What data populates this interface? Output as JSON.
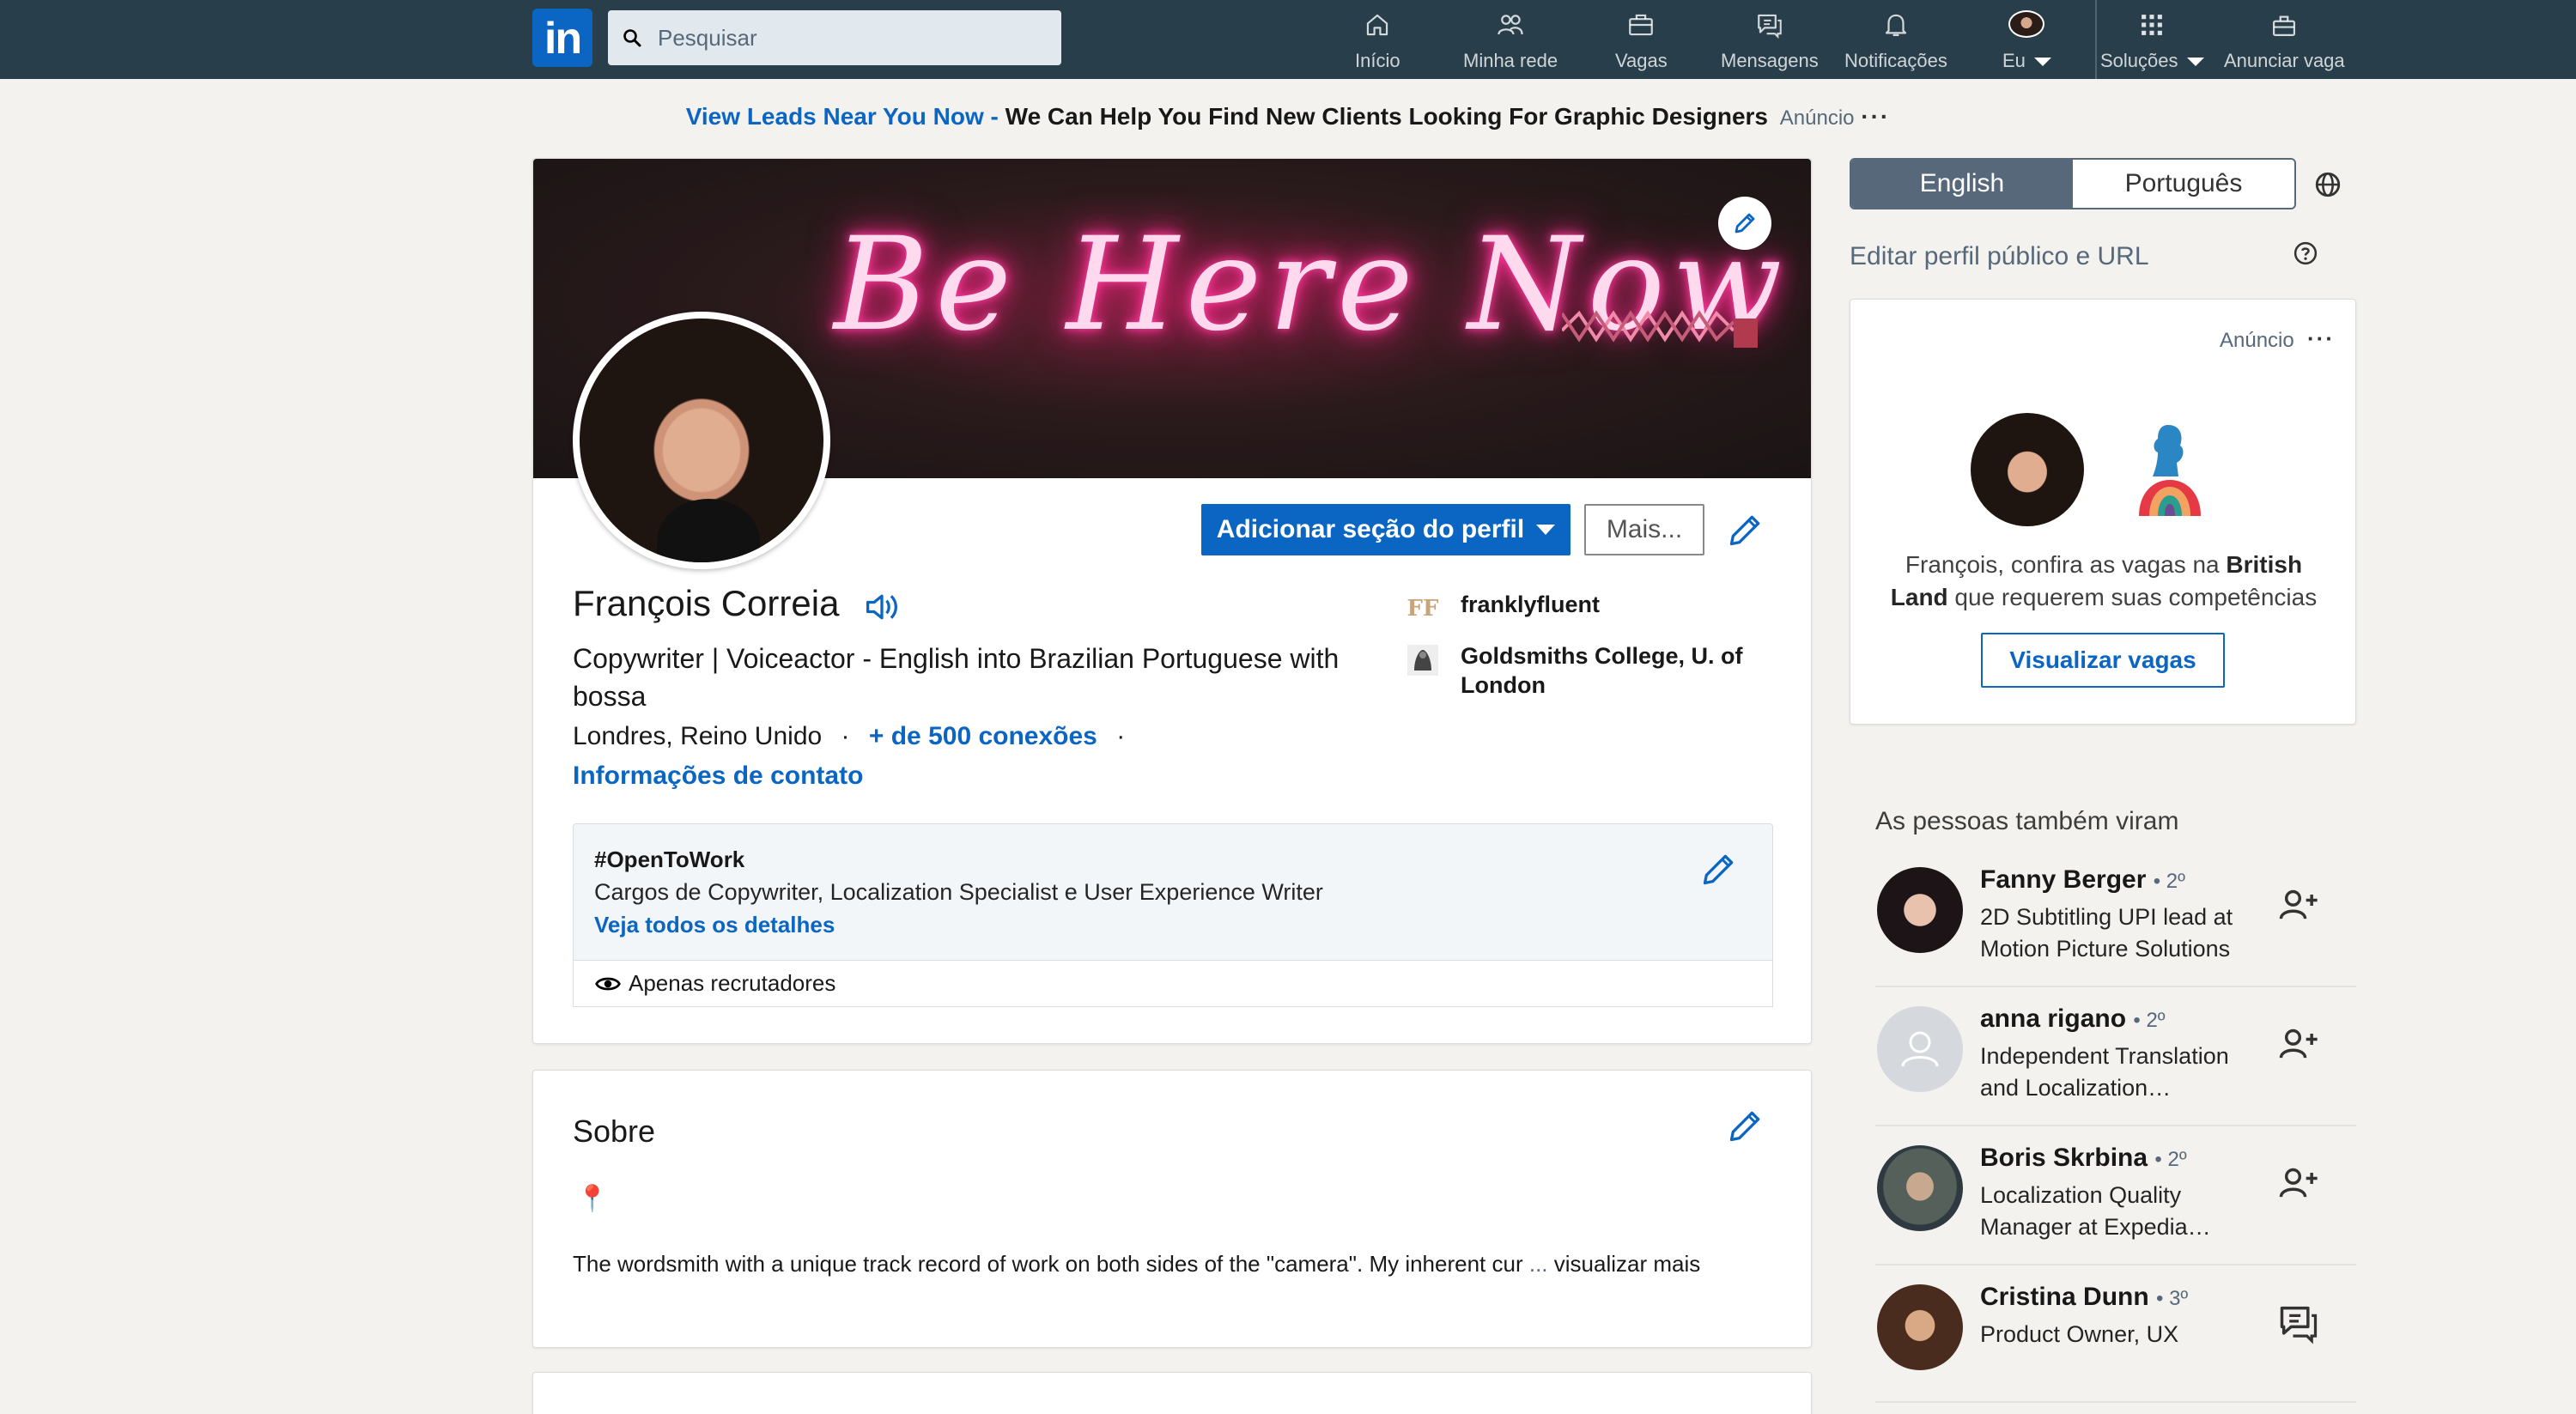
{
  "nav": {
    "logo": "in",
    "search_placeholder": "Pesquisar",
    "items": [
      {
        "label": "Início"
      },
      {
        "label": "Minha rede"
      },
      {
        "label": "Vagas"
      },
      {
        "label": "Mensagens"
      },
      {
        "label": "Notificações"
      },
      {
        "label": "Eu"
      },
      {
        "label": "Soluções"
      },
      {
        "label": "Anunciar vaga"
      }
    ]
  },
  "top_ad": {
    "link": "View Leads Near You Now",
    "separator": " - ",
    "text": "We Can Help You Find New Clients Looking For Graphic Designers",
    "label": "Anúncio",
    "dots": "···"
  },
  "profile": {
    "cover_text": "Be Here Now",
    "add_section_label": "Adicionar seção do perfil",
    "more_label": "Mais...",
    "name": "François Correia",
    "headline": "Copywriter | Voiceactor - English into Brazilian Portuguese with bossa",
    "location": "Londres, Reino Unido",
    "dot": "·",
    "connections": "+ de 500 conexões",
    "contact_info": "Informações de contato",
    "company_logo": "FF",
    "company": "franklyfluent",
    "school": "Goldsmiths College, U. of London",
    "open_to_work": {
      "title": "#OpenToWork",
      "description": "Cargos de Copywriter, Localization Specialist e User Experience Writer",
      "link": "Veja todos os detalhes",
      "visibility": "Apenas recrutadores"
    }
  },
  "about": {
    "title": "Sobre",
    "pin": "📍",
    "text": "The wordsmith with a unique track record of work on both sides of the \"camera\". My inherent cur",
    "ellipsis": " ... ",
    "more": "visualizar mais"
  },
  "right_rail": {
    "languages": [
      "English",
      "Português"
    ],
    "edit_public": "Editar perfil público e URL",
    "ad": {
      "label": "Anúncio",
      "dots": "···",
      "text_prefix": "François, confira as vagas na ",
      "company": "British Land",
      "text_suffix": " que requerem suas competências",
      "button": "Visualizar vagas"
    },
    "people_title": "As pessoas também viram",
    "people": [
      {
        "name": "Fanny Berger",
        "degree": "• 2º",
        "title": "2D Subtitling UPI lead at Motion Picture Solutions",
        "action": "connect-icon"
      },
      {
        "name": "anna rigano",
        "degree": "• 2º",
        "title": "Independent Translation and Localization…",
        "action": "connect-icon"
      },
      {
        "name": "Boris Skrbina",
        "degree": "• 2º",
        "title": "Localization Quality Manager at Expedia…",
        "action": "connect-icon"
      },
      {
        "name": "Cristina Dunn",
        "degree": "• 3º",
        "title": "Product Owner, UX",
        "action": "message-icon"
      }
    ]
  },
  "colors": {
    "nav_bg": "#283e4a",
    "brand_blue": "#0a66c2",
    "page_bg": "#f3f2ef"
  }
}
